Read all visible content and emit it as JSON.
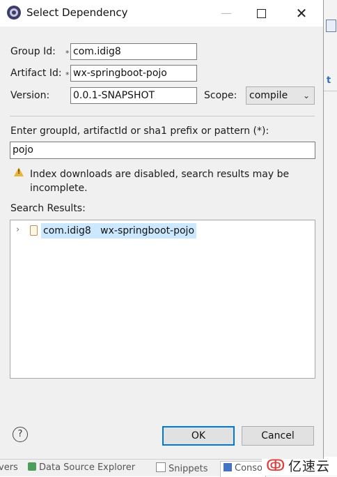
{
  "dialog": {
    "title": "Select Dependency",
    "window_controls": {
      "minimize": "—",
      "close": "✕"
    }
  },
  "form": {
    "group_id": {
      "label": "Group Id:",
      "value": "com.idig8",
      "required_mark": "*"
    },
    "artifact_id": {
      "label": "Artifact Id:",
      "value": "wx-springboot-pojo",
      "required_mark": "*"
    },
    "version": {
      "label": "Version:",
      "value": "0.0.1-SNAPSHOT"
    },
    "scope": {
      "label": "Scope:",
      "value": "compile"
    }
  },
  "search": {
    "label": "Enter groupId, artifactId or sha1 prefix or pattern (*):",
    "value": "pojo"
  },
  "warning": {
    "icon": "warning-icon",
    "text": "Index downloads are disabled, search results may be incomplete."
  },
  "results": {
    "label": "Search Results:",
    "items": [
      {
        "expander": "›",
        "group": "com.idig8",
        "artifact": "wx-springboot-pojo",
        "selected": true
      }
    ]
  },
  "buttons": {
    "help": "?",
    "ok": "OK",
    "cancel": "Cancel"
  },
  "background": {
    "side_letter": "t",
    "tabs": [
      "vers",
      "Data Source Explorer",
      "Snippets",
      "Conso"
    ],
    "logo_mark": "ↂ",
    "logo_text": "亿速云"
  },
  "colors": {
    "selection": "#cce8ff",
    "default_button_border": "#0078d7",
    "warning": "#e8b43a"
  }
}
